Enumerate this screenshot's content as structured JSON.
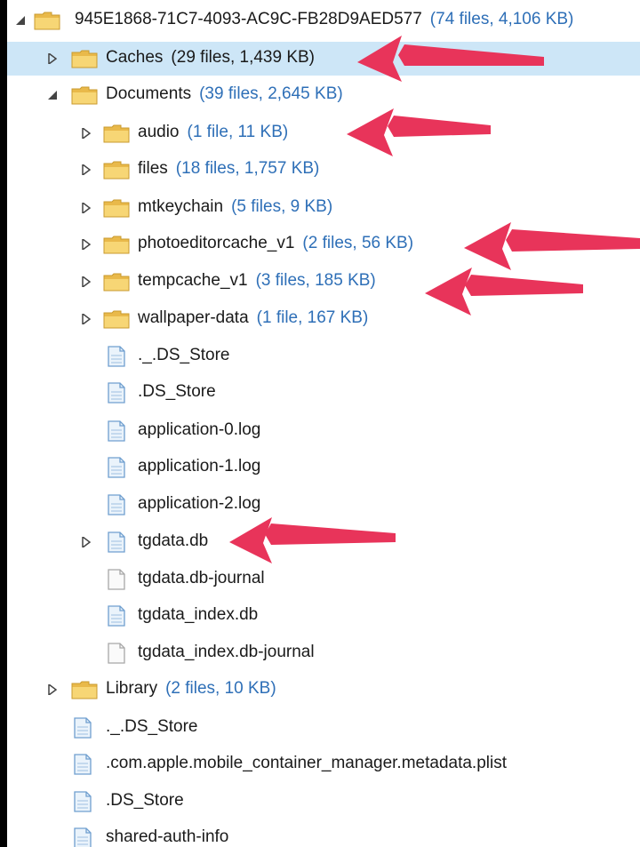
{
  "tree": {
    "root": {
      "name": "945E1868-71C7-4093-AC9C-FB28D9AED577",
      "meta": "(74 files, 4,106 KB)"
    },
    "caches": {
      "name": "Caches",
      "meta": "(29 files, 1,439 KB)"
    },
    "documents": {
      "name": "Documents",
      "meta": "(39 files, 2,645 KB)"
    },
    "audio": {
      "name": "audio",
      "meta": "(1 file, 11 KB)"
    },
    "files": {
      "name": "files",
      "meta": "(18 files, 1,757 KB)"
    },
    "mtkeychain": {
      "name": "mtkeychain",
      "meta": "(5 files, 9 KB)"
    },
    "photoeditorcache": {
      "name": "photoeditorcache_v1",
      "meta": "(2 files, 56 KB)"
    },
    "tempcache": {
      "name": "tempcache_v1",
      "meta": "(3 files, 185 KB)"
    },
    "wallpaper": {
      "name": "wallpaper-data",
      "meta": "(1 file, 167 KB)"
    },
    "doc_ds_store_dot": {
      "name": "._.DS_Store"
    },
    "doc_ds_store": {
      "name": ".DS_Store"
    },
    "log0": {
      "name": "application-0.log"
    },
    "log1": {
      "name": "application-1.log"
    },
    "log2": {
      "name": "application-2.log"
    },
    "tgdata": {
      "name": "tgdata.db"
    },
    "tgdata_journal": {
      "name": "tgdata.db-journal"
    },
    "tgdata_index": {
      "name": "tgdata_index.db"
    },
    "tgdata_index_journal": {
      "name": "tgdata_index.db-journal"
    },
    "library": {
      "name": "Library",
      "meta": "(2 files, 10 KB)"
    },
    "root_ds_store_dot": {
      "name": "._.DS_Store"
    },
    "metadata_plist": {
      "name": ".com.apple.mobile_container_manager.metadata.plist"
    },
    "root_ds_store": {
      "name": ".DS_Store"
    },
    "shared_auth": {
      "name": "shared-auth-info"
    }
  },
  "colors": {
    "meta_text": "#2e6fb7",
    "selection": "#cde6f7",
    "annotation_arrow": "#e8345a",
    "folder": "#f2c94c"
  }
}
